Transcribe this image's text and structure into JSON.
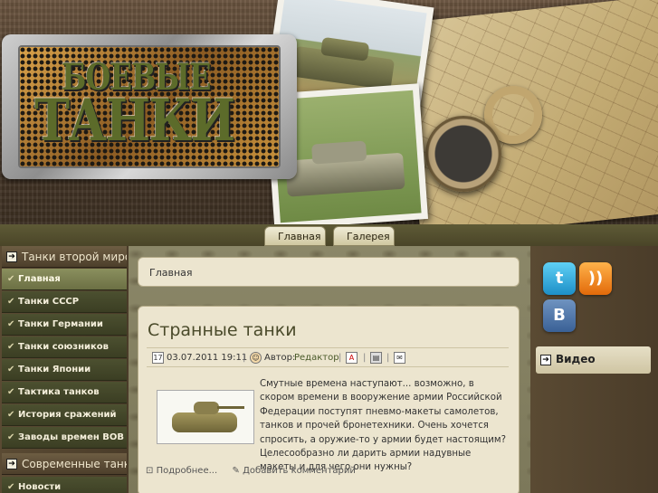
{
  "header": {
    "logo_line1": "БОЕВЫЕ",
    "logo_line2": "ТАНКИ"
  },
  "nav": {
    "tabs": [
      {
        "label": "Главная"
      },
      {
        "label": "Галерея"
      }
    ]
  },
  "sidebar_left": {
    "heading1": "Танки второй мировой",
    "items": [
      {
        "label": "Главная",
        "active": true
      },
      {
        "label": "Танки СССР"
      },
      {
        "label": "Танки Германии"
      },
      {
        "label": "Танки союзников"
      },
      {
        "label": "Танки Японии"
      },
      {
        "label": "Тактика танков"
      },
      {
        "label": "История сражений"
      },
      {
        "label": "Заводы времен ВОВ"
      }
    ],
    "heading2": "Современные танки",
    "items2": [
      {
        "label": "Новости"
      }
    ]
  },
  "main": {
    "breadcrumb": "Главная",
    "article": {
      "title": "Странные танки",
      "date": "03.07.2011 19:11",
      "author_label": "Автор:",
      "author": "Редактор",
      "body": "Смутные времена наступают... возможно, в скором времени в вооружение армии Российской Федерации поступят пневмо-макеты самолетов, танков и прочей бронетехники. Очень хочется спросить, а оружие-то у армии будет настоящим? Целесообразно ли дарить армии надувные макеты и для чего они нужны?",
      "read_more": "Подробнее...",
      "add_comment": "Добавить комментарий"
    }
  },
  "sidebar_right": {
    "social": [
      {
        "icon": "twitter-icon",
        "glyph": "t"
      },
      {
        "icon": "rss-icon",
        "glyph": "))"
      },
      {
        "icon": "vk-icon",
        "glyph": "В"
      }
    ],
    "video_label": "Видео"
  }
}
